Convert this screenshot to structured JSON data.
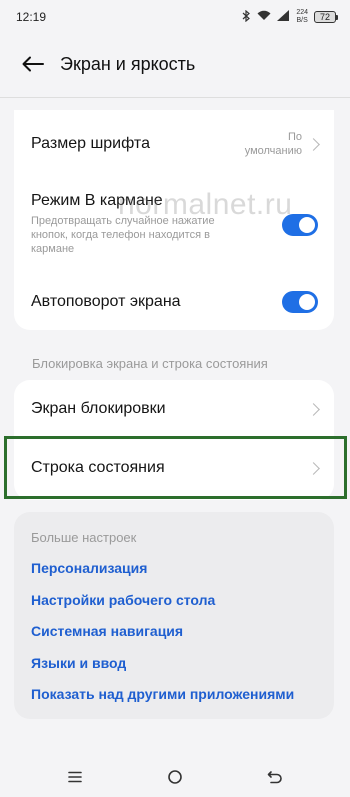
{
  "status_bar": {
    "time": "12:19",
    "speed_value": "224",
    "speed_unit": "B/S",
    "battery": "72",
    "icons": [
      "bluetooth-icon",
      "wifi-icon",
      "signal-icon"
    ]
  },
  "header": {
    "title": "Экран и яркость",
    "back_icon": "back-arrow-icon"
  },
  "watermark": "normalnet.ru",
  "card1": {
    "font_size": {
      "title": "Размер шрифта",
      "value_line1": "По",
      "value_line2": "умолчанию"
    },
    "pocket_mode": {
      "title": "Режим В кармане",
      "description_line1": "Предотвращать случайное нажатие",
      "description_line2": "кнопок, когда телефон находится в",
      "description_line3": "кармане",
      "enabled": true
    },
    "auto_rotate": {
      "title": "Автоповорот экрана",
      "enabled": true
    }
  },
  "section_lock": {
    "label": "Блокировка экрана и строка состояния",
    "items": [
      {
        "label": "Экран блокировки"
      },
      {
        "label": "Строка состояния"
      }
    ]
  },
  "more_settings": {
    "title": "Больше настроек",
    "links": [
      "Персонализация",
      "Настройки рабочего стола",
      "Системная навигация",
      "Языки и ввод",
      "Показать над другими приложениями"
    ]
  },
  "colors": {
    "accent": "#1f6fe5",
    "link": "#1f5fd0",
    "highlight_border": "#2c6e2c"
  },
  "navbar": {
    "icons": [
      "menu-icon",
      "home-icon",
      "back-icon"
    ]
  }
}
